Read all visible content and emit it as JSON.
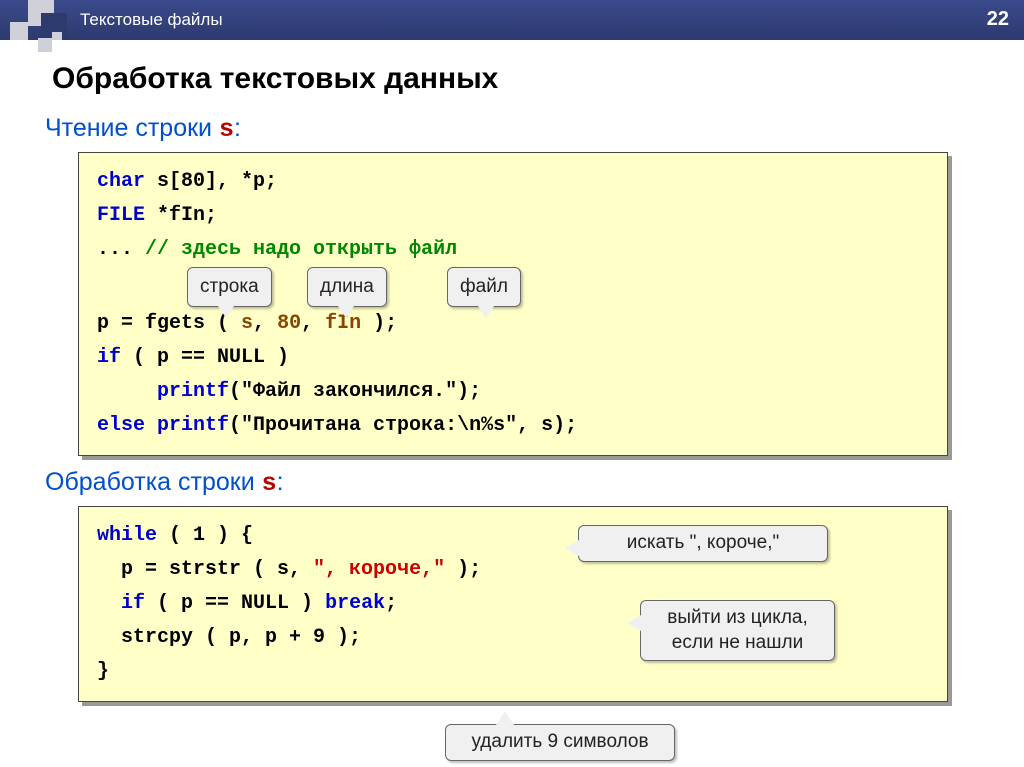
{
  "header": {
    "title": "Текстовые файлы",
    "page_number": "22"
  },
  "main_title": "Обработка текстовых данных",
  "section1": {
    "title_prefix": "Чтение строки ",
    "title_code": "s",
    "title_suffix": ":",
    "code": {
      "l1_kw": "char",
      "l1_rest": " s[80], *p;",
      "l2_kw": "FILE",
      "l2_rest": " *fIn;",
      "l3a": "... ",
      "l3_comment": "// здесь надо открыть файл",
      "l4a": "p = fgets ( ",
      "l4b": "s",
      "l4c": ", ",
      "l4d": "80",
      "l4e": ", ",
      "l4f": "fIn",
      "l4g": " );",
      "l5_kw": "if",
      "l5_rest": " ( p == NULL )",
      "l6_kw": "printf",
      "l6_rest": "(\"Файл закончился.\");",
      "l7_kw": "else",
      "l7_fn": " printf",
      "l7_rest": "(\"Прочитана строка:\\n%s\", s);"
    },
    "pills": {
      "p1": "строка",
      "p2": "длина",
      "p3": "файл"
    }
  },
  "section2": {
    "title_prefix": "Обработка строки ",
    "title_code": "s",
    "title_suffix": ":",
    "code": {
      "l1_kw": "while",
      "l1_rest": " ( 1 ) {",
      "l2a": "  p = strstr ( s, ",
      "l2b": "\", короче,\"",
      "l2c": " );",
      "l3_kw": "if",
      "l3_mid": " ( p == NULL ) ",
      "l3_brk": "break",
      "l3_end": ";",
      "l4": "  strcpy ( p, p + 9 );",
      "l5": "}"
    },
    "callouts": {
      "c1": "искать \", короче,\"",
      "c2a": "выйти из цикла,",
      "c2b": "если не нашли",
      "c3": "удалить 9 символов"
    }
  }
}
